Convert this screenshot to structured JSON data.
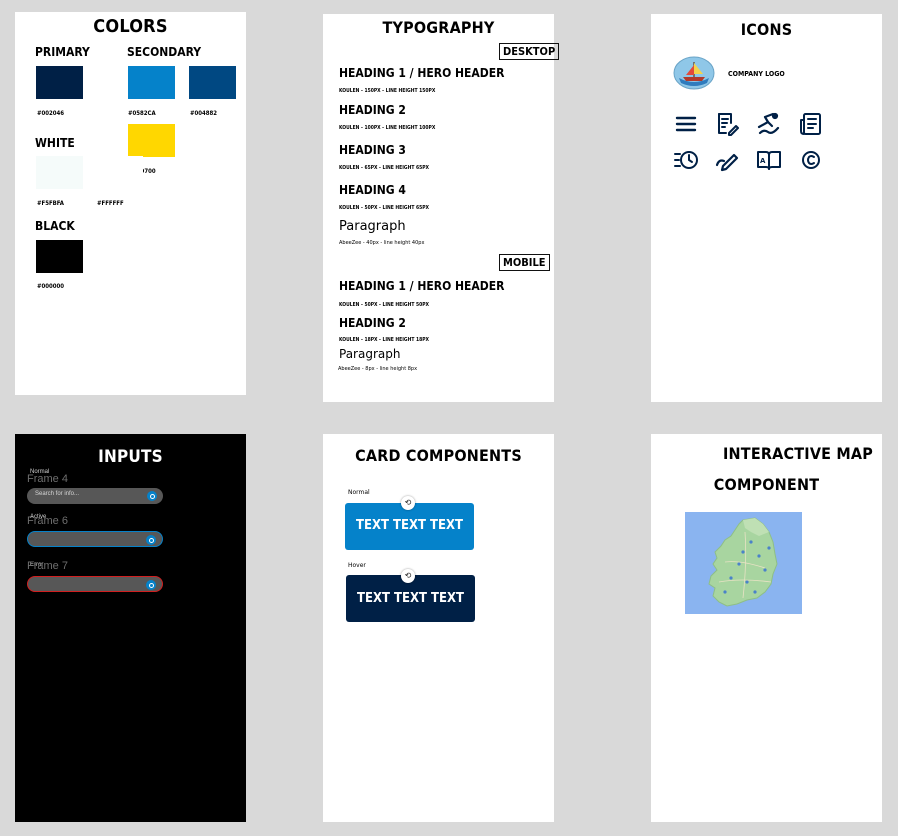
{
  "colors": {
    "title": "Colors",
    "primary_label": "Primary",
    "secondary_label": "Secondary",
    "white_label": "White",
    "black_label": "Black",
    "primary": {
      "hex": "#002046",
      "label": "#002046"
    },
    "secondary": [
      {
        "hex": "#0582CA",
        "label": "#0582CA"
      },
      {
        "hex": "#004882",
        "label": "#004882"
      },
      {
        "hex": "#FFD700",
        "label": "#FFD700"
      }
    ],
    "white": [
      {
        "hex": "#F5FBFA",
        "label": "#F5FBFA"
      },
      {
        "hex": "#FFFFFF",
        "label": "#FFFFFF"
      }
    ],
    "black": {
      "hex": "#000000",
      "label": "#000000"
    }
  },
  "typography": {
    "title": "Typography",
    "desktop_badge": "Desktop",
    "mobile_badge": "Mobile",
    "desktop": {
      "h1": "Heading 1 / Hero Header",
      "h1_meta": "Koulen - 150px - line height 150px",
      "h2": "Heading 2",
      "h2_meta": "Koulen - 100px - line height 100px",
      "h3": "Heading 3",
      "h3_meta": "Koulen - 65px - line height 65px",
      "h4": "Heading 4",
      "h4_meta": "Koulen - 50px - line height 65px",
      "para": "Paragraph",
      "para_meta": "AbeeZee - 40px - line height 40px"
    },
    "mobile": {
      "h1": "Heading 1 / Hero Header",
      "h1_meta": "Koulen - 50px - line height 50px",
      "h2": "Heading 2",
      "h2_meta": "Koulen - 18px - line height 18px",
      "para": "Paragraph",
      "para_meta": "AbeeZee - 8px - line height 8px"
    }
  },
  "icons": {
    "title": "Icons",
    "logo_label": "Company Logo",
    "names": [
      "menu-icon",
      "document-edit-icon",
      "swimmer-icon",
      "news-icon",
      "history-list-icon",
      "pen-icon",
      "open-book-icon",
      "copyright-icon"
    ],
    "color": "#002046"
  },
  "inputs": {
    "title": "Inputs",
    "frames": [
      {
        "frame": "Frame 4",
        "state": "Normal",
        "placeholder": "Search for info...",
        "border": "none"
      },
      {
        "frame": "Frame 6",
        "state": "Active",
        "placeholder": "",
        "border": "#0582CA"
      },
      {
        "frame": "Frame 7",
        "state": "Error",
        "placeholder": "",
        "border": "#d11f1f"
      }
    ]
  },
  "cards": {
    "title": "Card Components",
    "normal_label": "Normal",
    "hover_label": "Hover",
    "normal_text": "Text Text Text",
    "hover_text": "Text Text Text",
    "normal_color": "#0582CA",
    "hover_color": "#002046"
  },
  "map": {
    "title_line1": "Interactive Map",
    "title_line2": "Component",
    "water_color": "#8ab4f0",
    "land_color": "#a8d5a0"
  }
}
